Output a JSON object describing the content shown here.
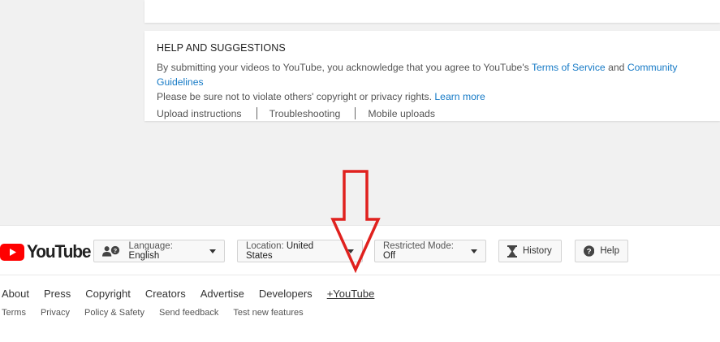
{
  "help": {
    "title": "HELP AND SUGGESTIONS",
    "text_before_tos": "By submitting your videos to YouTube, you acknowledge that you agree to YouTube's ",
    "tos_link": "Terms of Service",
    "text_and": " and ",
    "guidelines_link": "Community Guidelines",
    "text_line2": ". Please be sure not to violate others' copyright or privacy rights. ",
    "learn_more": "Learn more",
    "links": [
      "Upload instructions",
      "Troubleshooting",
      "Mobile uploads"
    ]
  },
  "footer": {
    "logo_text": "YouTube",
    "language": {
      "label": "Language: ",
      "value": "English"
    },
    "location": {
      "label": "Location: ",
      "value": "United States"
    },
    "restricted": {
      "label": "Restricted Mode: ",
      "value": "Off"
    },
    "history_label": "History",
    "help_label": "Help",
    "primary_links": [
      "About",
      "Press",
      "Copyright",
      "Creators",
      "Advertise",
      "Developers",
      "+YouTube"
    ],
    "secondary_links": [
      "Terms",
      "Privacy",
      "Policy & Safety",
      "Send feedback",
      "Test new features"
    ]
  },
  "colors": {
    "link": "#167ac6",
    "annotation_arrow": "#e0211e",
    "youtube_red": "#ff0000"
  }
}
